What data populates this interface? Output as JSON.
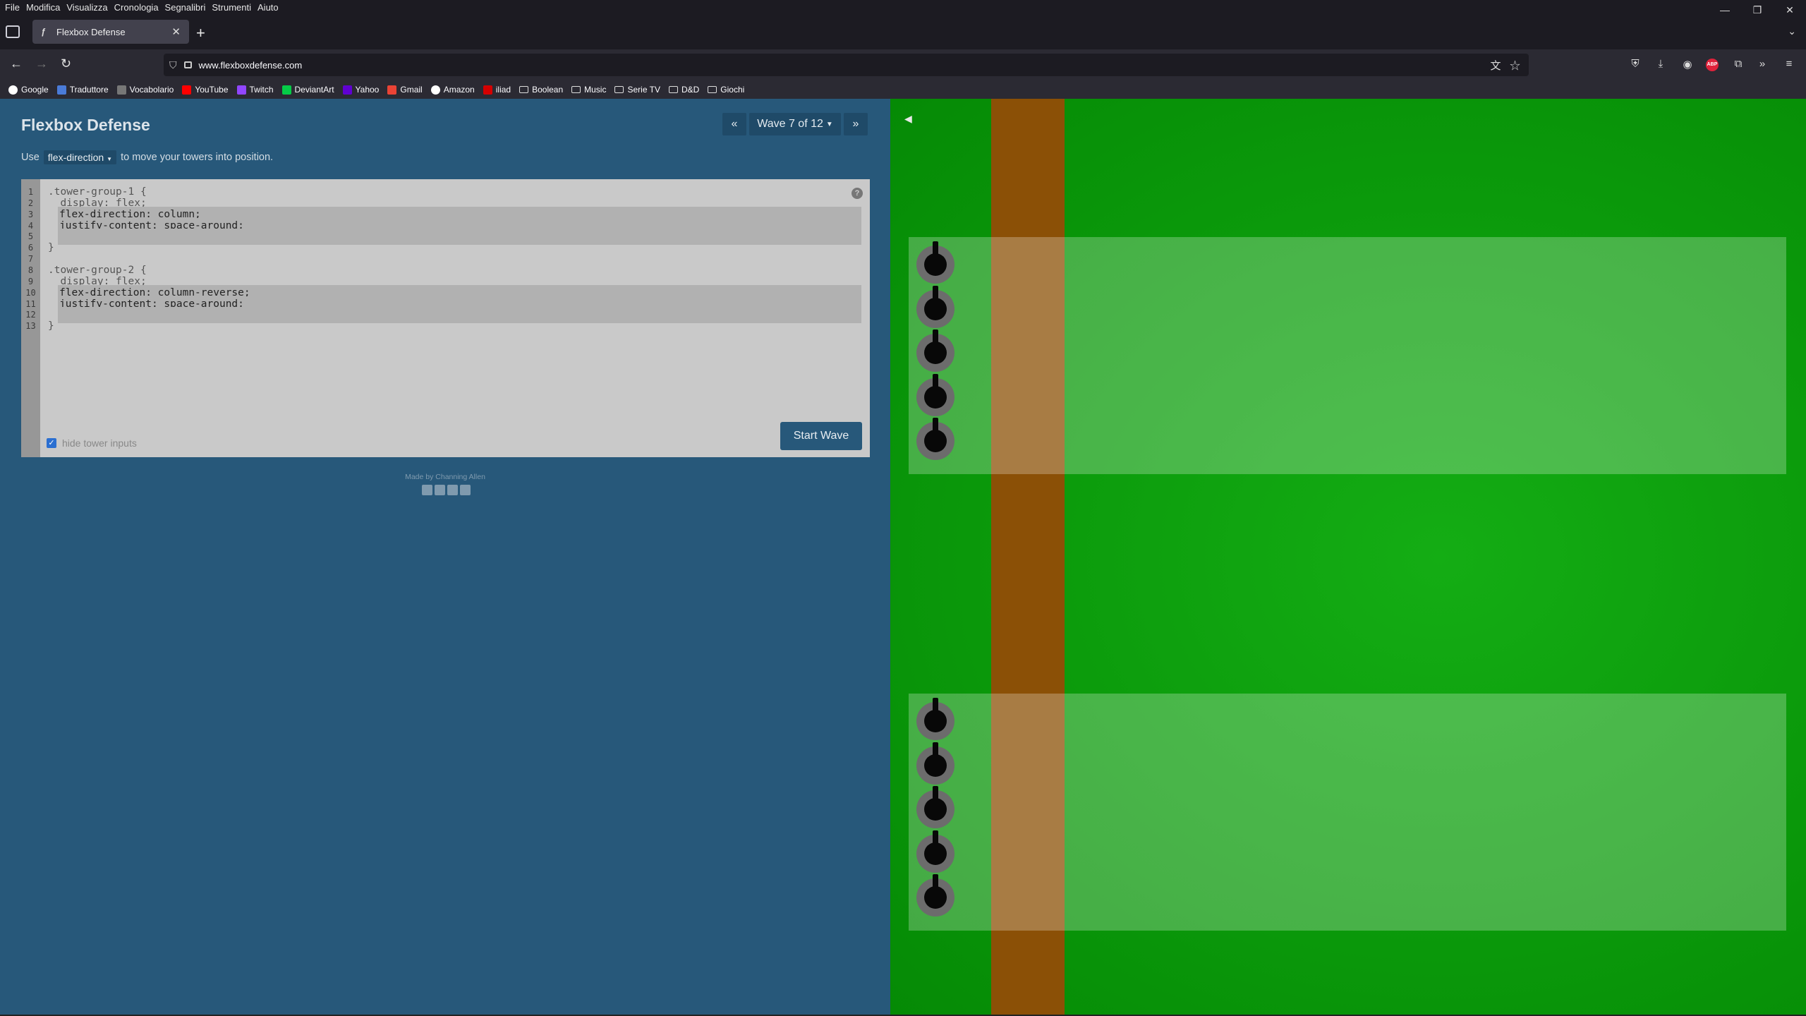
{
  "browser": {
    "menu": [
      "File",
      "Modifica",
      "Visualizza",
      "Cronologia",
      "Segnalibri",
      "Strumenti",
      "Aiuto"
    ],
    "tab_title": "Flexbox Defense",
    "url": "www.flexboxdefense.com",
    "bookmarks": [
      {
        "label": "Google",
        "icon": "google-icon",
        "color": "#ffffff"
      },
      {
        "label": "Traduttore",
        "icon": "translate-icon",
        "color": "#4a7bd8"
      },
      {
        "label": "Vocabolario",
        "icon": "book-icon",
        "color": "#777777"
      },
      {
        "label": "YouTube",
        "icon": "youtube-icon",
        "color": "#ff0000"
      },
      {
        "label": "Twitch",
        "icon": "twitch-icon",
        "color": "#9146ff"
      },
      {
        "label": "DeviantArt",
        "icon": "deviantart-icon",
        "color": "#05cc47"
      },
      {
        "label": "Yahoo",
        "icon": "yahoo-icon",
        "color": "#6001d2"
      },
      {
        "label": "Gmail",
        "icon": "gmail-icon",
        "color": "#ea4335"
      },
      {
        "label": "Amazon",
        "icon": "amazon-icon",
        "color": "#ffffff"
      },
      {
        "label": "iliad",
        "icon": "iliad-icon",
        "color": "#d40000"
      },
      {
        "label": "Boolean",
        "icon": "folder-icon",
        "color": ""
      },
      {
        "label": "Music",
        "icon": "folder-icon",
        "color": ""
      },
      {
        "label": "Serie TV",
        "icon": "folder-icon",
        "color": ""
      },
      {
        "label": "D&D",
        "icon": "folder-icon",
        "color": ""
      },
      {
        "label": "Giochi",
        "icon": "folder-icon",
        "color": ""
      }
    ]
  },
  "app": {
    "title": "Flexbox Defense",
    "instruction_prefix": "Use",
    "property_dropdown": "flex-direction",
    "instruction_suffix": "to move your towers into position.",
    "wave_label": "Wave 7 of 12",
    "prev": "«",
    "next": "»",
    "start_wave": "Start Wave",
    "hide_tower_inputs": "hide tower inputs",
    "credits": "Made by Channing Allen"
  },
  "editor": {
    "lines": [
      {
        "n": "1",
        "text": ".tower-group-1 {",
        "input": false
      },
      {
        "n": "2",
        "text": "  display: flex;",
        "input": false
      },
      {
        "n": "3",
        "text": "flex-direction: column;",
        "input": true
      },
      {
        "n": "4",
        "text": "justify-content: space-around;",
        "input": true
      },
      {
        "n": "5",
        "text": "",
        "input": true
      },
      {
        "n": "6",
        "text": "}",
        "input": false
      },
      {
        "n": "7",
        "text": "",
        "input": false
      },
      {
        "n": "8",
        "text": ".tower-group-2 {",
        "input": false
      },
      {
        "n": "9",
        "text": "  display: flex;",
        "input": false
      },
      {
        "n": "10",
        "text": "flex-direction: column-reverse;",
        "input": true
      },
      {
        "n": "11",
        "text": "justify-content: space-around;",
        "input": true
      },
      {
        "n": "12",
        "text": "",
        "input": true
      },
      {
        "n": "13",
        "text": "}",
        "input": false
      }
    ]
  },
  "board": {
    "colors": {
      "grass": "#0b9a0b",
      "road": "#8b5006",
      "tower_base": "#6c6c6c"
    },
    "groups": [
      {
        "name": "tower-group-1",
        "towers": 5
      },
      {
        "name": "tower-group-2",
        "towers": 5
      }
    ]
  }
}
